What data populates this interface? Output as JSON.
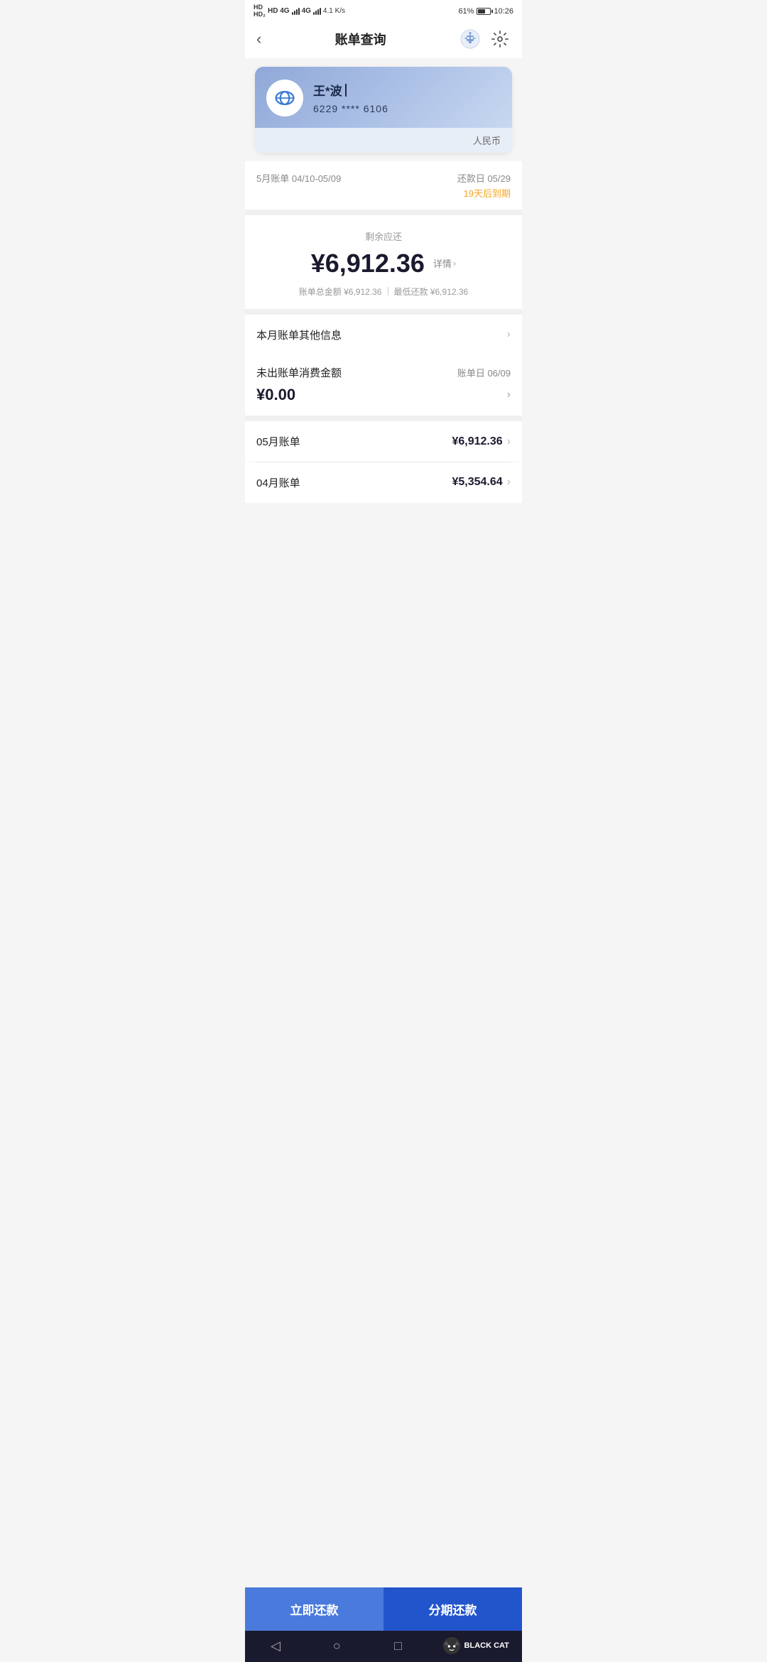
{
  "statusBar": {
    "network": "HD 4G",
    "signal": "4G",
    "speed": "4.1 K/s",
    "battery": "61%",
    "time": "10:26"
  },
  "header": {
    "title": "账单查询",
    "backLabel": "‹",
    "settingsIcon": "gear-icon",
    "avatarIcon": "avatar-icon"
  },
  "card": {
    "userName": "王*波",
    "cardNumber": "6229 **** 6106",
    "currency": "人民币"
  },
  "billPeriod": {
    "periodLabel": "5月账单 04/10-05/09",
    "dueDateLabel": "还款日 05/29",
    "dueDaysLabel": "19天后到期"
  },
  "amount": {
    "remainingLabel": "剩余应还",
    "value": "¥6,912.36",
    "detailLabel": "详情",
    "totalLabel": "账单总金额 ¥6,912.36",
    "minPayLabel": "最低还款 ¥6,912.36"
  },
  "infoSection": {
    "otherInfoLabel": "本月账单其他信息"
  },
  "uncleared": {
    "label": "未出账单消费金额",
    "dateLabel": "账单日 06/09",
    "amount": "¥0.00"
  },
  "monthBills": [
    {
      "label": "05月账单",
      "amount": "¥6,912.36"
    },
    {
      "label": "04月账单",
      "amount": "¥5,354.64"
    }
  ],
  "buttons": {
    "immediate": "立即还款",
    "installment": "分期还款"
  },
  "bottomNav": {
    "back": "◁",
    "home": "○",
    "recent": "□"
  },
  "watermark": "BLACK CAT"
}
